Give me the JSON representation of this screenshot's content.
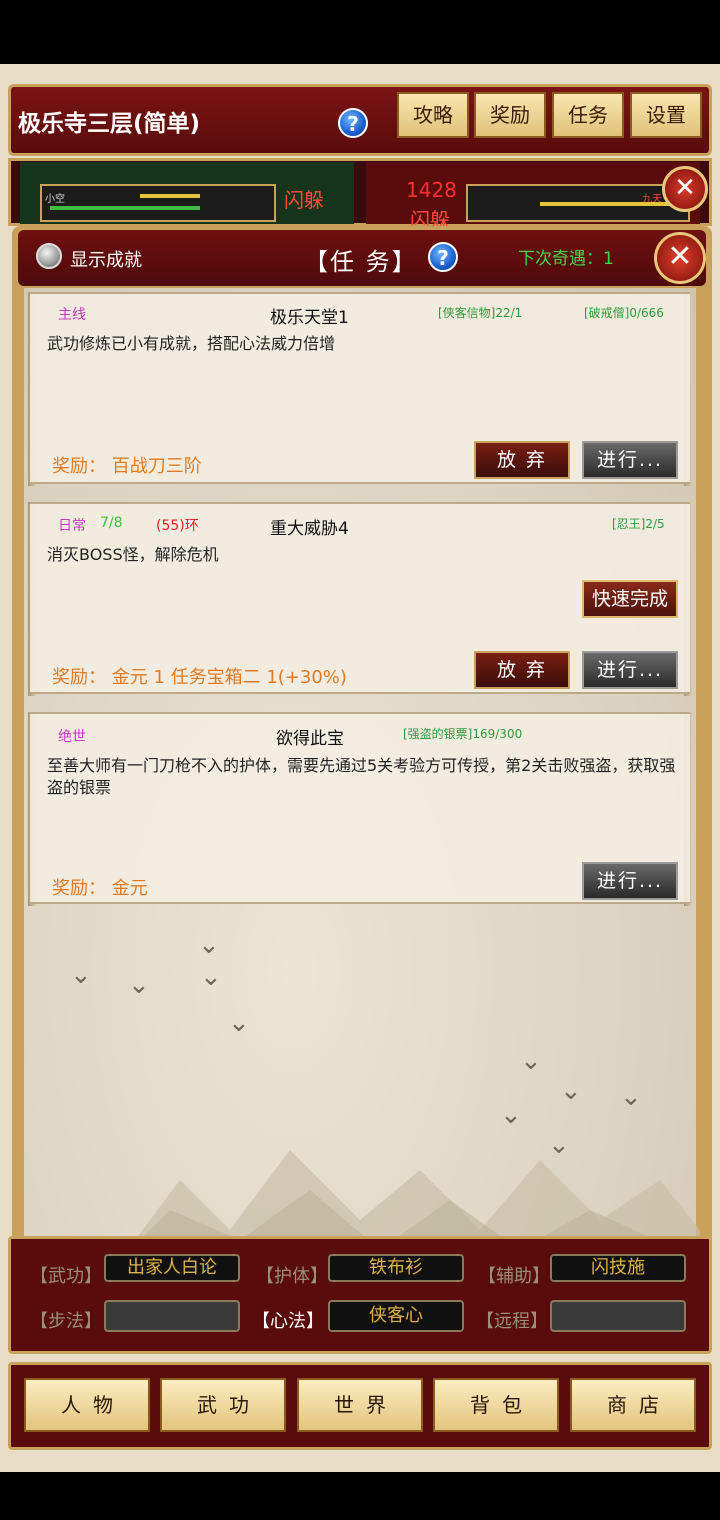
{
  "header": {
    "map_title": "极乐寺三层(简单)",
    "help_icon": "?",
    "buttons": [
      "攻略",
      "奖励",
      "任务",
      "设置"
    ]
  },
  "battle": {
    "enemy_name": "小空",
    "dodge_left": "闪躲",
    "damage": "1428",
    "dodge_right": "闪躲",
    "player_name": "九天",
    "close_glyph": "✕"
  },
  "quest_window": {
    "show_achievement_label": "显示成就",
    "title": "【任 务】",
    "help_icon": "?",
    "next_encounter": "下次奇遇：1",
    "close_glyph": "✕",
    "quests": [
      {
        "type": "主线",
        "name": "极乐天堂1",
        "progress": [
          "[侠客信物]22/1",
          "[破戒僧]0/666"
        ],
        "desc": "武功修炼已小有成就，搭配心法威力倍增",
        "reward": "奖励：  百战刀三阶",
        "abandon": "放 弃",
        "go": "进行..."
      },
      {
        "type": "日常",
        "count": "7/8",
        "ring": "(55)环",
        "name": "重大威胁4",
        "progress": [
          "[忍王]2/5"
        ],
        "desc": "消灭BOSS怪，解除危机",
        "quick": "快速完成",
        "reward": "奖励：  金元 1  任务宝箱二 1(+30%)",
        "abandon": "放 弃",
        "go": "进行..."
      },
      {
        "type": "绝世",
        "name": "欲得此宝",
        "progress": [
          "[强盗的银票]169/300"
        ],
        "desc": "至善大师有一门刀枪不入的护体，需要先通过5关考验方可传授，第2关击败强盗，获取强盗的银票",
        "reward": "奖励：  金元",
        "go": "进行..."
      }
    ]
  },
  "skills": {
    "row1": [
      "【武功】",
      "出家人白论",
      "【护体】",
      "铁布衫",
      "【辅助】",
      "闪技施"
    ],
    "row2_labels": [
      "【步法】",
      "【心法】",
      "【远程】"
    ],
    "xinfa_value": "侠客心"
  },
  "nav": [
    "人物",
    "武功",
    "世界",
    "背包",
    "商店"
  ],
  "colors": {
    "accent_red": "#5a0c0c",
    "gold_border": "#c9a15a",
    "reward_orange": "#e07a22",
    "progress_green": "#2f9a3a",
    "type_magenta": "#c038c0"
  }
}
